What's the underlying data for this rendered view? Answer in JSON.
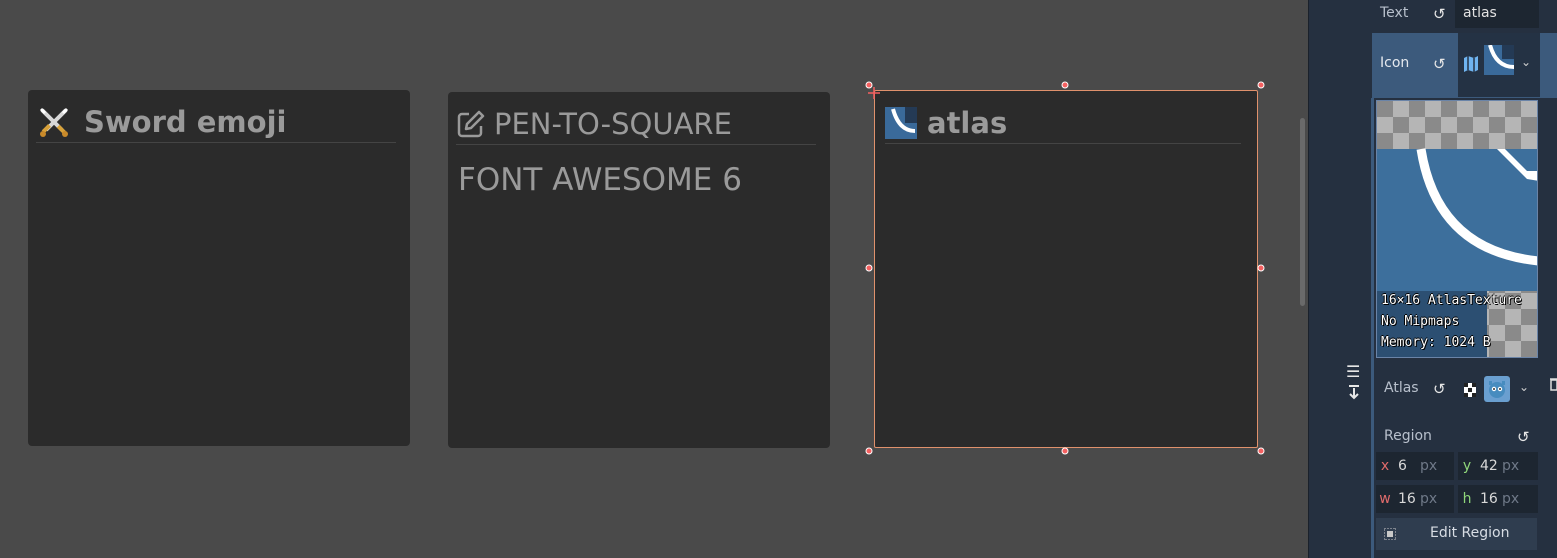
{
  "viewport": {
    "panels": [
      {
        "title": "Sword emoji",
        "icon": "crossed-swords-icon"
      },
      {
        "title": "PEN-TO-SQUARE",
        "subtitle": "FONT AWESOME 6",
        "icon": "pen-to-square-icon"
      },
      {
        "title": "atlas",
        "icon": "atlas-texture-icon"
      }
    ],
    "selection_color": "#e0916c"
  },
  "inspector": {
    "text_label": "Text",
    "text_value": "atlas",
    "icon_label": "Icon",
    "atlas_label": "Atlas",
    "region_label": "Region",
    "preview_info": [
      "16×16 AtlasTexture",
      "No Mipmaps",
      "Memory: 1024 B"
    ],
    "region": {
      "x_label": "x",
      "x": "6",
      "x_unit": "px",
      "y_label": "y",
      "y": "42",
      "y_unit": "px",
      "w_label": "w",
      "w": "16",
      "w_unit": "px",
      "h_label": "h",
      "h": "16",
      "h_unit": "px"
    },
    "edit_region_label": "Edit Region",
    "accent_color": "#3c5a7c"
  }
}
